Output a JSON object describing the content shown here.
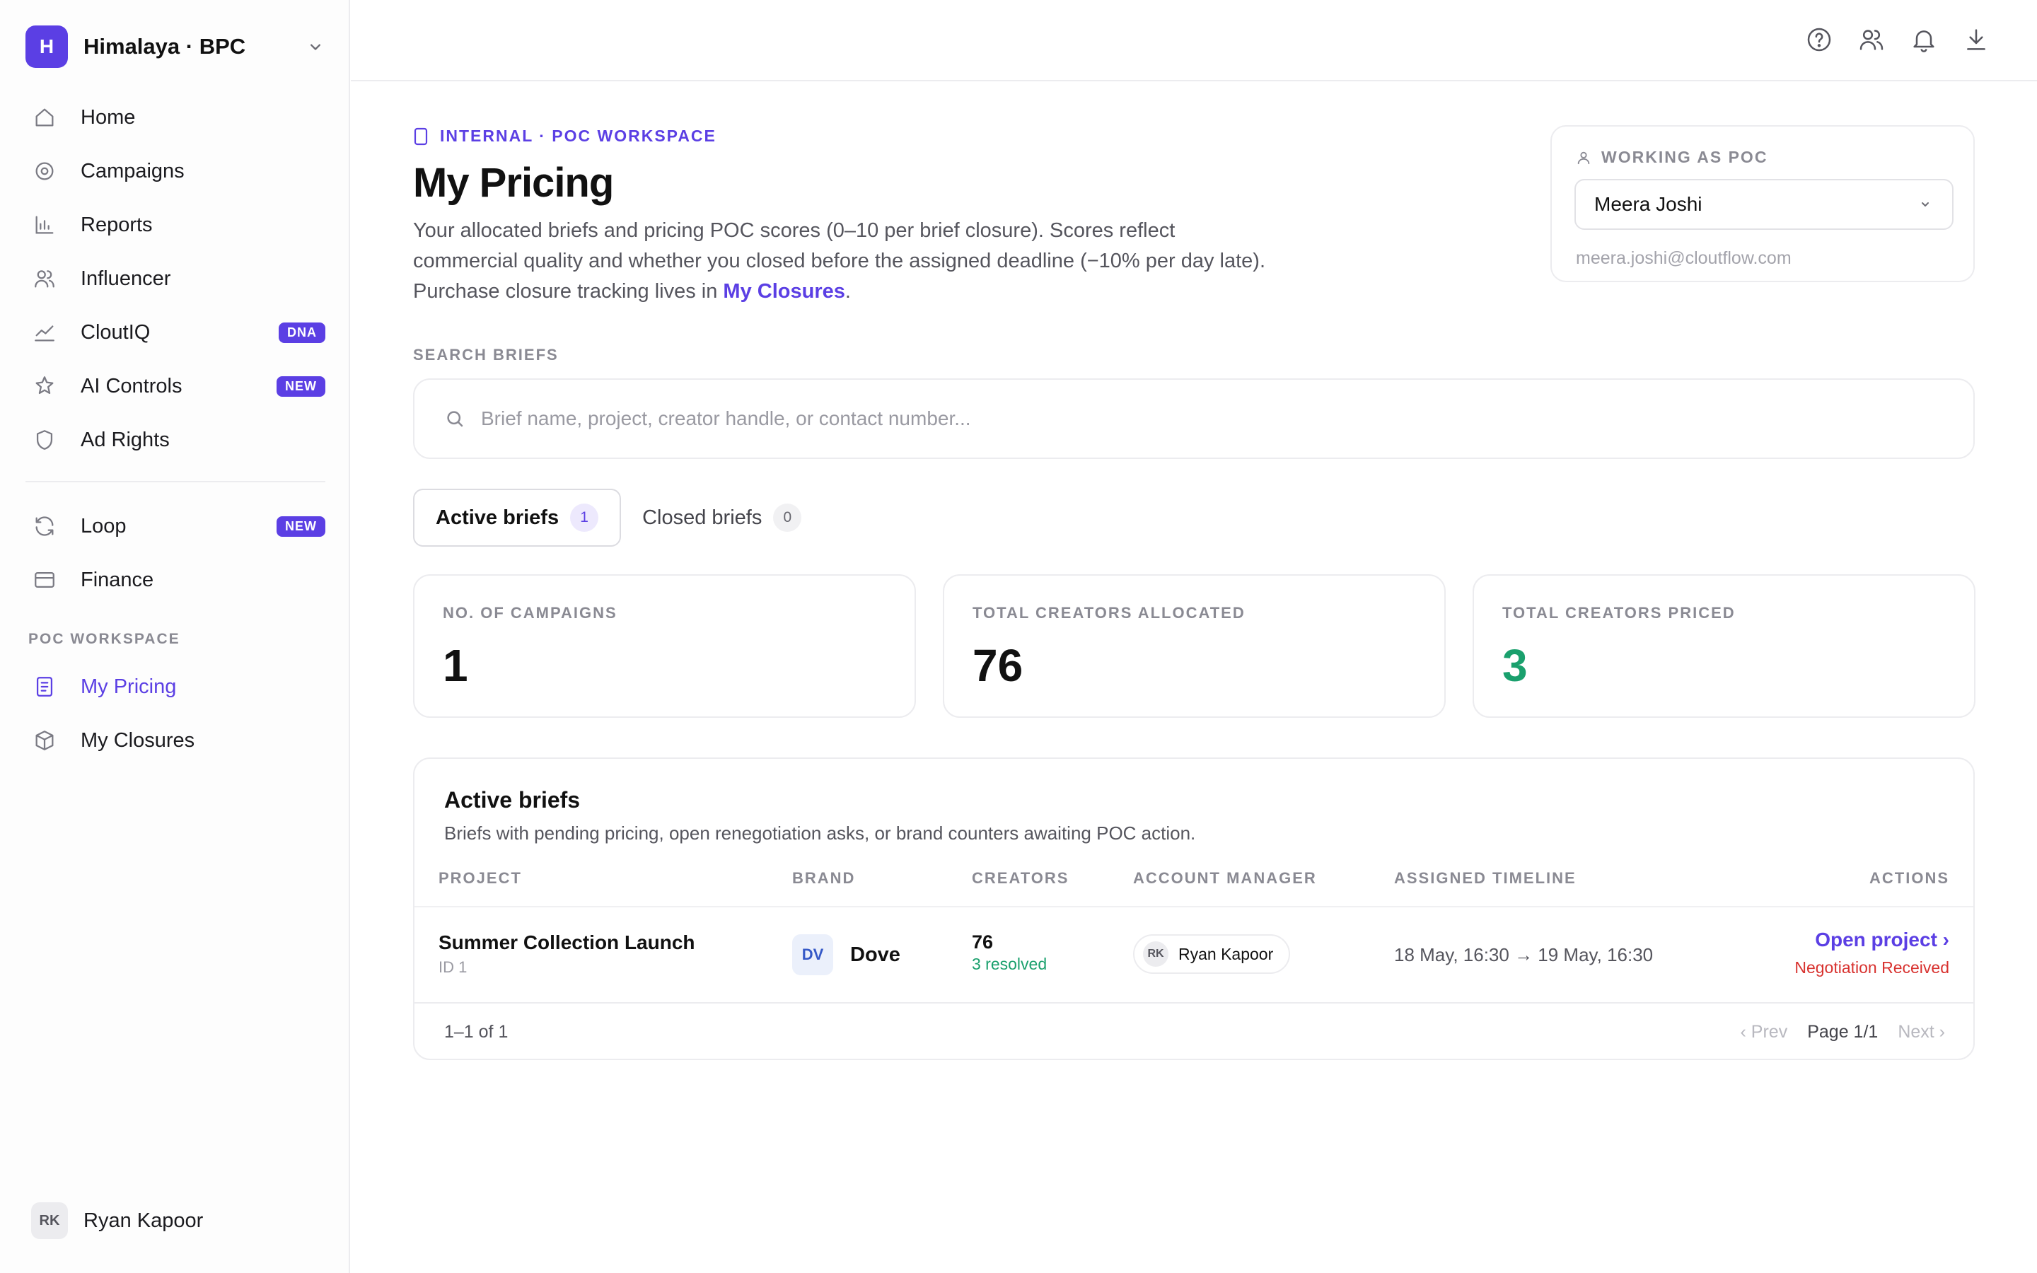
{
  "org": {
    "badge": "H",
    "name": "Himalaya · BPC"
  },
  "nav": [
    {
      "label": "Home",
      "icon": "home-icon"
    },
    {
      "label": "Campaigns",
      "icon": "target-icon"
    },
    {
      "label": "Reports",
      "icon": "bar-chart-icon"
    },
    {
      "label": "Influencer",
      "icon": "users-icon"
    },
    {
      "label": "CloutIQ",
      "icon": "trend-icon",
      "badge": "DNA"
    },
    {
      "label": "AI Controls",
      "icon": "sparkle-icon",
      "badge": "NEW"
    },
    {
      "label": "Ad Rights",
      "icon": "shield-icon"
    }
  ],
  "nav2": [
    {
      "label": "Loop",
      "icon": "refresh-icon",
      "badge": "NEW"
    },
    {
      "label": "Finance",
      "icon": "card-icon"
    }
  ],
  "poc_section_label": "POC WORKSPACE",
  "nav3": [
    {
      "label": "My Pricing",
      "icon": "document-icon",
      "active": true
    },
    {
      "label": "My Closures",
      "icon": "box-icon"
    }
  ],
  "footer_user": {
    "initials": "RK",
    "name": "Ryan Kapoor"
  },
  "header": {
    "eyebrow": "INTERNAL · POC WORKSPACE",
    "title": "My Pricing",
    "desc_lines": [
      "Your allocated briefs and pricing POC scores (0–10 per brief closure). Scores reflect",
      "commercial quality and whether you closed before the assigned deadline (−10% per day late)."
    ],
    "desc_prefix": "Purchase closure tracking lives in ",
    "desc_link": "My Closures",
    "desc_suffix": "."
  },
  "poc": {
    "label": "WORKING AS POC",
    "selected": "Meera Joshi",
    "email": "meera.joshi@cloutflow.com"
  },
  "search": {
    "label": "SEARCH BRIEFS",
    "placeholder": "Brief name, project, creator handle, or contact number...",
    "value": ""
  },
  "tabs": [
    {
      "label": "Active briefs",
      "count": "1"
    },
    {
      "label": "Closed briefs",
      "count": "0"
    }
  ],
  "stats": [
    {
      "label": "NO. OF CAMPAIGNS",
      "value": "1"
    },
    {
      "label": "TOTAL CREATORS ALLOCATED",
      "value": "76"
    },
    {
      "label": "TOTAL CREATORS PRICED",
      "value": "3"
    }
  ],
  "table": {
    "title": "Active briefs",
    "subtitle": "Briefs with pending pricing, open renegotiation asks, or brand counters awaiting POC action.",
    "columns": [
      "PROJECT",
      "BRAND",
      "CREATORS",
      "ACCOUNT MANAGER",
      "ASSIGNED TIMELINE",
      "ACTIONS"
    ],
    "rows": [
      {
        "project": "Summer Collection Launch",
        "project_id": "ID 1",
        "brand_initials": "DV",
        "brand": "Dove",
        "creators": "76",
        "resolved": "3 resolved",
        "am_initials": "RK",
        "am_name": "Ryan Kapoor",
        "timeline": "18 May, 16:30 → 19 May, 16:30",
        "action": "Open project ›",
        "status": "Negotiation Received"
      }
    ],
    "pager_count": "1–1 of 1",
    "prev": "‹ Prev",
    "page": "Page 1/1",
    "next": "Next ›"
  },
  "colors": {
    "accent": "#5b3fe4",
    "success": "#1aa06d",
    "danger": "#d8322f"
  }
}
